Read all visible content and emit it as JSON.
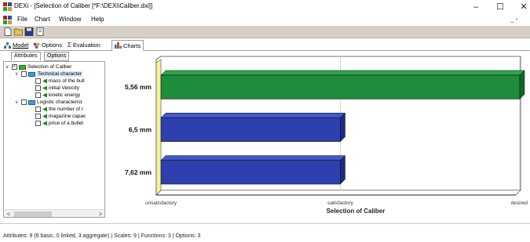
{
  "window": {
    "title": "DEXi - [Selection of Caliber [*F:\\DEXi\\Caliber.dxi]]",
    "controls": {
      "minimize": "–",
      "maximize": "☐",
      "close": "✕"
    },
    "mdi_controls": "_ ▫"
  },
  "menu": {
    "items": [
      "File",
      "Chart",
      "Window",
      "Help"
    ]
  },
  "toolbar": {
    "buttons": [
      "new-icon",
      "open-icon",
      "save-icon",
      "properties-icon"
    ]
  },
  "tabs": [
    {
      "label": "Model",
      "icon": "model-icon"
    },
    {
      "label": "Options",
      "icon": "options-icon"
    },
    {
      "label": "Evaluation",
      "icon": "sigma-icon"
    },
    {
      "label": "Charts",
      "icon": "charts-icon",
      "active": true
    }
  ],
  "left_pane": {
    "subtabs": [
      {
        "label": "Attributes",
        "active": true
      },
      {
        "label": "Options"
      }
    ],
    "tree": [
      {
        "label": "Selection of Caliber",
        "level": 0,
        "type": "root",
        "checked": true,
        "expanded": true
      },
      {
        "label": "Technical character",
        "level": 1,
        "type": "aggregate",
        "checked": false,
        "expanded": true,
        "selected": true
      },
      {
        "label": "mass of the bull",
        "level": 2,
        "type": "basic",
        "checked": false
      },
      {
        "label": "initial Velocity",
        "level": 2,
        "type": "basic",
        "checked": false
      },
      {
        "label": "kinetic energy",
        "level": 2,
        "type": "basic",
        "checked": false
      },
      {
        "label": "Logistic characterist",
        "level": 1,
        "type": "aggregate",
        "checked": false,
        "expanded": true
      },
      {
        "label": "the number of r",
        "level": 2,
        "type": "basic",
        "checked": false
      },
      {
        "label": "magazine capac",
        "level": 2,
        "type": "basic",
        "checked": false
      },
      {
        "label": "price of a bullet",
        "level": 2,
        "type": "basic",
        "checked": false
      }
    ],
    "scroll": {
      "left": "<",
      "right": ">"
    }
  },
  "chart_data": {
    "type": "bar",
    "orientation": "horizontal",
    "categories": [
      "5,56 mm",
      "6,5 mm",
      "7,62 mm"
    ],
    "x_ticks": [
      "unsatisfactory",
      "satisfactory",
      "desired"
    ],
    "values": [
      2,
      1,
      1
    ],
    "xlim": [
      0,
      2
    ],
    "xlabel": "Selection of Caliber",
    "ylabel": "",
    "title": "",
    "bar_colors": [
      "#1e8c3a",
      "#2e3fae",
      "#2e3fae"
    ],
    "grid": true
  },
  "status": {
    "text": "Attributes: 9 (6 basic, 0 linked, 3 aggregate)  |  Scales: 9  |  Functions: 3  |  Options: 3"
  }
}
